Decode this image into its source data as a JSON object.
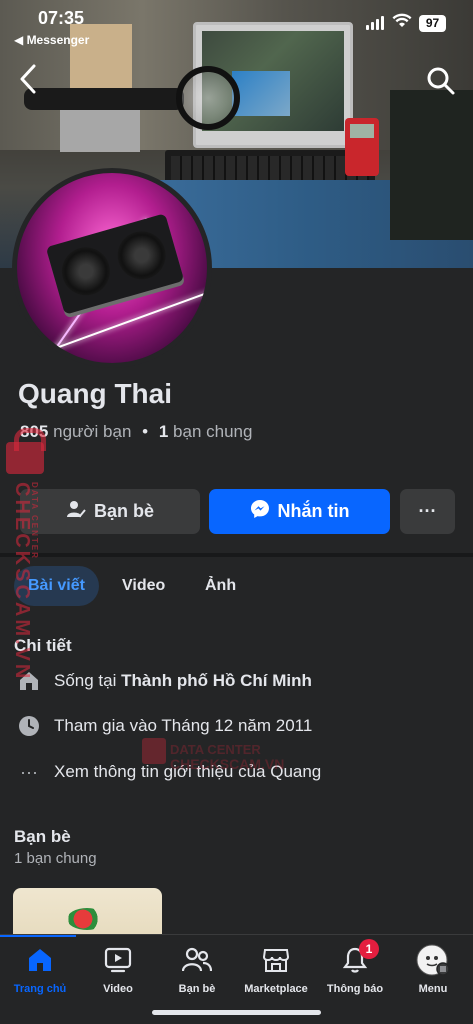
{
  "status_bar": {
    "time": "07:35",
    "back_app": "◀ Messenger",
    "battery": "97"
  },
  "profile": {
    "name": "Quang Thai",
    "friends_count": "805",
    "friends_label": "người bạn",
    "separator": "•",
    "mutual_count": "1",
    "mutual_label": "bạn chung"
  },
  "actions": {
    "friends_button": "Bạn bè",
    "message_button": "Nhắn tin",
    "more_button": "···"
  },
  "tabs": [
    {
      "label": "Bài viết",
      "active": true
    },
    {
      "label": "Video",
      "active": false
    },
    {
      "label": "Ảnh",
      "active": false
    }
  ],
  "details": {
    "title": "Chi tiết",
    "lives_prefix": "Sống tại ",
    "lives_city": "Thành phố Hồ Chí Minh",
    "joined": "Tham gia vào Tháng 12 năm 2011",
    "about_link": "Xem thông tin giới thiệu của Quang"
  },
  "friends_section": {
    "title": "Bạn bè",
    "subtitle": "1 bạn chung"
  },
  "bottom_nav": [
    {
      "label": "Trang chủ",
      "icon": "home-icon",
      "active": true
    },
    {
      "label": "Video",
      "icon": "video-icon",
      "active": false
    },
    {
      "label": "Bạn bè",
      "icon": "friends-icon",
      "active": false
    },
    {
      "label": "Marketplace",
      "icon": "marketplace-icon",
      "active": false
    },
    {
      "label": "Thông báo",
      "icon": "bell-icon",
      "active": false,
      "badge": "1"
    },
    {
      "label": "Menu",
      "icon": "menu-avatar-icon",
      "active": false
    }
  ],
  "watermark": {
    "vertical": "CHECKSCAM.VN",
    "vertical_small": "DATA CENTER",
    "center_small": "DATA CENTER",
    "center": "CHECKSCAM.VN"
  },
  "colors": {
    "background": "#242526",
    "accent": "#0866ff",
    "badge": "#e41e3f",
    "text_primary": "#e4e6eb",
    "text_secondary": "#b0b3b8"
  }
}
